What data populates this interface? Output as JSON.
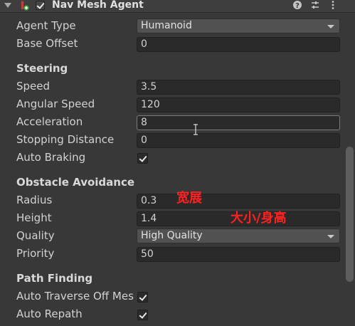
{
  "header": {
    "title": "Nav Mesh Agent",
    "enabled": true,
    "icons": [
      "fold-arrow-icon",
      "nav-agent-component-icon",
      "help-icon",
      "presets-icon",
      "more-menu-icon"
    ]
  },
  "fields": {
    "agent_type": {
      "label": "Agent Type",
      "value": "Humanoid"
    },
    "base_offset": {
      "label": "Base Offset",
      "value": "0"
    }
  },
  "steering": {
    "title": "Steering",
    "speed": {
      "label": "Speed",
      "value": "3.5"
    },
    "angular_speed": {
      "label": "Angular Speed",
      "value": "120"
    },
    "acceleration": {
      "label": "Acceleration",
      "value": "8"
    },
    "stopping_distance": {
      "label": "Stopping Distance",
      "value": "0"
    },
    "auto_braking": {
      "label": "Auto Braking",
      "checked": true
    }
  },
  "obstacle": {
    "title": "Obstacle Avoidance",
    "radius": {
      "label": "Radius",
      "value": "0.3"
    },
    "height": {
      "label": "Height",
      "value": "1.4"
    },
    "quality": {
      "label": "Quality",
      "value": "High Quality"
    },
    "priority": {
      "label": "Priority",
      "value": "50"
    }
  },
  "path": {
    "title": "Path Finding",
    "auto_traverse": {
      "label": "Auto Traverse Off Mes",
      "checked": true
    },
    "auto_repath": {
      "label": "Auto Repath",
      "checked": true
    }
  },
  "annotations": {
    "radius_note": "宽展",
    "height_note": "大小/身高"
  },
  "colors": {
    "background": "#383838",
    "field_bg": "#2a2a2a",
    "dropdown_bg": "#515151",
    "annotation_red": "#ff2020"
  }
}
